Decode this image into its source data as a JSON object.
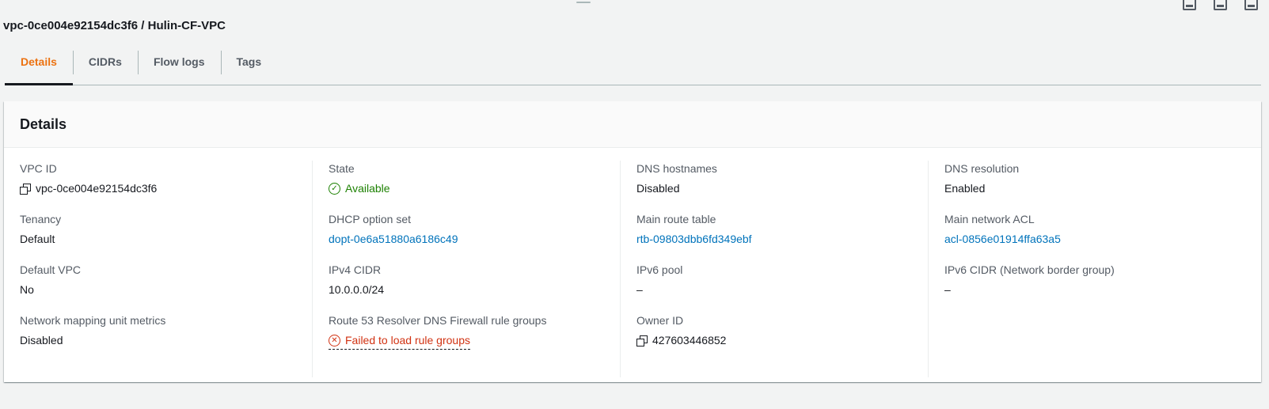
{
  "page_title": "vpc-0ce004e92154dc3f6 / Hulin-CF-VPC",
  "tabs": [
    {
      "label": "Details",
      "active": true
    },
    {
      "label": "CIDRs",
      "active": false
    },
    {
      "label": "Flow logs",
      "active": false
    },
    {
      "label": "Tags",
      "active": false
    }
  ],
  "card": {
    "title": "Details",
    "col1": {
      "vpc_id_label": "VPC ID",
      "vpc_id_value": "vpc-0ce004e92154dc3f6",
      "tenancy_label": "Tenancy",
      "tenancy_value": "Default",
      "default_vpc_label": "Default VPC",
      "default_vpc_value": "No",
      "nmu_label": "Network mapping unit metrics",
      "nmu_value": "Disabled"
    },
    "col2": {
      "state_label": "State",
      "state_value": "Available",
      "dhcp_label": "DHCP option set",
      "dhcp_value": "dopt-0e6a51880a6186c49",
      "ipv4_label": "IPv4 CIDR",
      "ipv4_value": "10.0.0.0/24",
      "r53_label": "Route 53 Resolver DNS Firewall rule groups",
      "r53_value": "Failed to load rule groups"
    },
    "col3": {
      "dns_hostnames_label": "DNS hostnames",
      "dns_hostnames_value": "Disabled",
      "main_rt_label": "Main route table",
      "main_rt_value": "rtb-09803dbb6fd349ebf",
      "ipv6_pool_label": "IPv6 pool",
      "ipv6_pool_value": "–",
      "owner_label": "Owner ID",
      "owner_value": "427603446852"
    },
    "col4": {
      "dns_resolution_label": "DNS resolution",
      "dns_resolution_value": "Enabled",
      "main_acl_label": "Main network ACL",
      "main_acl_value": "acl-0856e01914ffa63a5",
      "ipv6_cidr_label": "IPv6 CIDR (Network border group)",
      "ipv6_cidr_value": "–"
    }
  },
  "colors": {
    "link": "#0073bb",
    "success": "#1d8102",
    "error": "#d13212",
    "active_tab": "#ec7211"
  },
  "icons": {
    "copy": "copy-icon",
    "status_ok": "check-circle-icon",
    "status_error": "x-circle-icon"
  }
}
